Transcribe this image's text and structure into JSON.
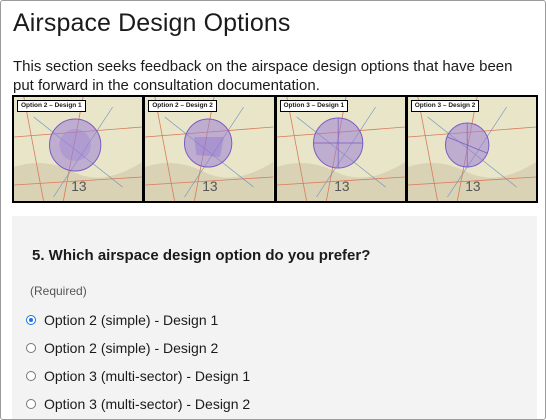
{
  "page": {
    "title": "Airspace Design Options",
    "intro": "This section seeks feedback on the airspace design options that have been put forward in the consultation documentation."
  },
  "maps": [
    {
      "label": "Option 2 – Design 1"
    },
    {
      "label": "Option 2 – Design 2"
    },
    {
      "label": "Option 3 – Design 1"
    },
    {
      "label": "Option 3 – Design 2"
    }
  ],
  "question": {
    "text": "5. Which airspace design option do you prefer?",
    "required": "(Required)",
    "options": [
      {
        "label": "Option 2 (simple) - Design 1",
        "selected": true
      },
      {
        "label": "Option 2 (simple) - Design 2",
        "selected": false
      },
      {
        "label": "Option 3 (multi-sector) - Design 1",
        "selected": false
      },
      {
        "label": "Option 3 (multi-sector) - Design 2",
        "selected": false
      }
    ]
  },
  "colors": {
    "radio_selected": "#1a73e8",
    "airspace_fill": "#9b7fd6",
    "map_base": "#e9e6c9"
  }
}
